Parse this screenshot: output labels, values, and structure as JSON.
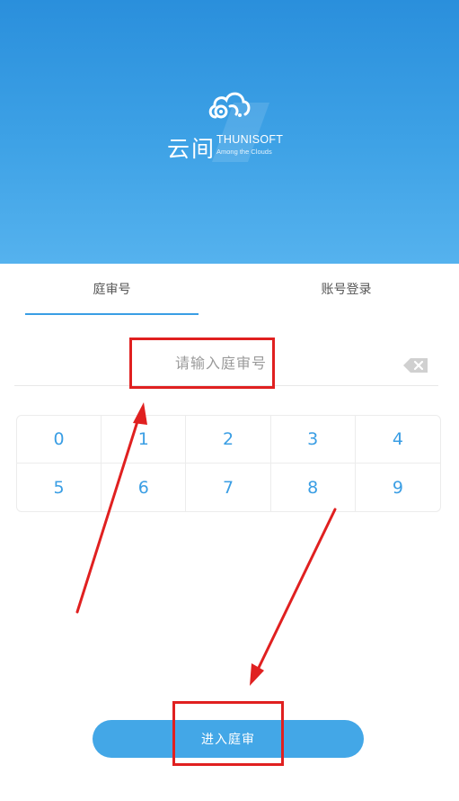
{
  "header": {
    "logo_cn": "云间",
    "logo_en": "THUNISOFT",
    "logo_slogan": "Among the Clouds"
  },
  "tabs": [
    {
      "label": "庭审号",
      "active": true
    },
    {
      "label": "账号登录",
      "active": false
    }
  ],
  "input": {
    "placeholder": "请输入庭审号",
    "value": ""
  },
  "keypad": {
    "keys": [
      "0",
      "1",
      "2",
      "3",
      "4",
      "5",
      "6",
      "7",
      "8",
      "9"
    ]
  },
  "enter_button": {
    "label": "进入庭审"
  },
  "colors": {
    "accent": "#3a9ee4",
    "header_top": "#2a8fdc",
    "button": "#43a7e7",
    "annotation": "#e02020"
  },
  "icons": {
    "logo": "cloud-logo-icon",
    "backspace": "backspace-icon"
  }
}
